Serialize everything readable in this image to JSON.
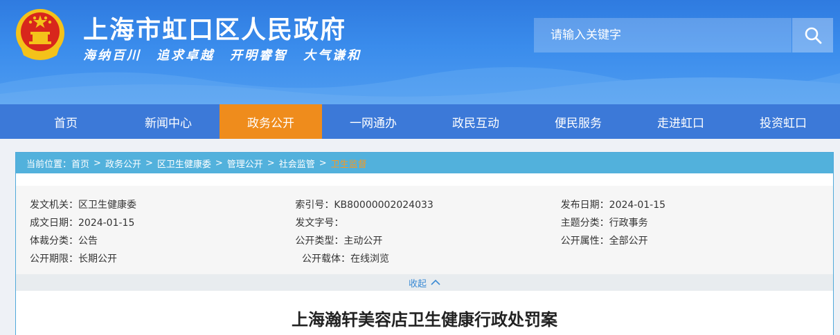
{
  "header": {
    "site_title": "上海市虹口区人民政府",
    "slogans": [
      "海纳百川",
      "追求卓越",
      "开明睿智",
      "大气谦和"
    ],
    "search_placeholder": "请输入关键字"
  },
  "nav": {
    "items": [
      "首页",
      "新闻中心",
      "政务公开",
      "一网通办",
      "政民互动",
      "便民服务",
      "走进虹口",
      "投资虹口"
    ],
    "active_index": 2
  },
  "breadcrumb": {
    "prefix": "当前位置：",
    "items": [
      "首页",
      "政务公开",
      "区卫生健康委",
      "管理公开",
      "社会监管"
    ],
    "current": "卫生监督"
  },
  "meta": {
    "rows": [
      [
        {
          "k": "发文机关：",
          "v": "区卫生健康委"
        },
        {
          "k": "索引号：",
          "v": "KB80000002024033"
        },
        {
          "k": "发布日期：",
          "v": "2024-01-15"
        }
      ],
      [
        {
          "k": "成文日期：",
          "v": "2024-01-15"
        },
        {
          "k": "发文字号：",
          "v": ""
        },
        {
          "k": "主题分类：",
          "v": "行政事务"
        }
      ],
      [
        {
          "k": "体裁分类：",
          "v": "公告"
        },
        {
          "k": "公开类型：",
          "v": "主动公开"
        },
        {
          "k": "公开属性：",
          "v": "全部公开"
        }
      ],
      [
        {
          "k": "公开期限：",
          "v": "长期公开"
        },
        {
          "k": "公开载体：",
          "v": "在线浏览"
        }
      ]
    ],
    "collapse_label": "收起"
  },
  "doc": {
    "title": "上海瀚轩美容店卫生健康行政处罚案"
  },
  "colors": {
    "header_blue": "#3a8cec",
    "nav_blue": "#3c79d8",
    "nav_active": "#ef8c1c",
    "breadcrumb_bg": "#52b1dc",
    "breadcrumb_current": "#f59a23"
  }
}
